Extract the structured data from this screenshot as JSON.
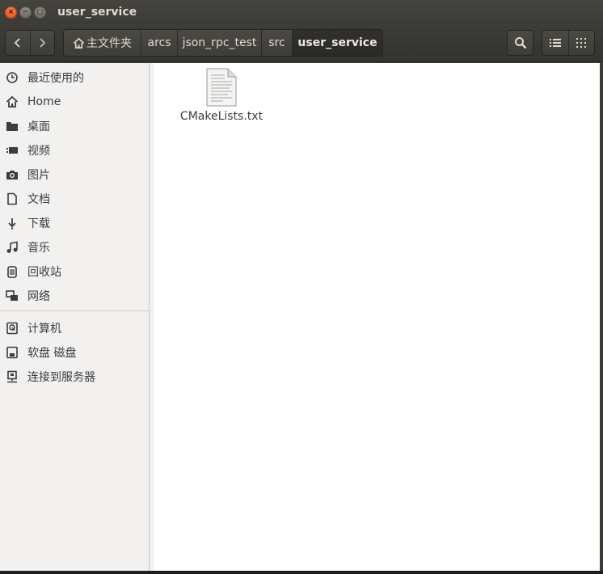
{
  "window": {
    "title": "user_service",
    "close_glyph": "×",
    "minimize_glyph": "−",
    "maximize_glyph": "□"
  },
  "toolbar": {
    "back_icon": "chevron-left-icon",
    "forward_icon": "chevron-right-icon",
    "search_icon": "search-icon",
    "list_view_icon": "list-view-icon",
    "grid_view_icon": "grid-view-icon"
  },
  "breadcrumb": {
    "home_label": "主文件夹",
    "items": [
      "arcs",
      "json_rpc_test",
      "src",
      "user_service"
    ]
  },
  "sidebar": {
    "places": [
      {
        "label": "最近使用的",
        "icon": "clock-icon"
      },
      {
        "label": "Home",
        "icon": "home-icon"
      },
      {
        "label": "桌面",
        "icon": "folder-icon"
      },
      {
        "label": "视频",
        "icon": "video-icon"
      },
      {
        "label": "图片",
        "icon": "camera-icon"
      },
      {
        "label": "文档",
        "icon": "document-icon"
      },
      {
        "label": "下载",
        "icon": "download-icon"
      },
      {
        "label": "音乐",
        "icon": "music-icon"
      },
      {
        "label": "回收站",
        "icon": "trash-icon"
      },
      {
        "label": "网络",
        "icon": "network-icon"
      }
    ],
    "devices": [
      {
        "label": "计算机",
        "icon": "computer-icon"
      },
      {
        "label": "软盘 磁盘",
        "icon": "floppy-icon"
      },
      {
        "label": "连接到服务器",
        "icon": "server-icon"
      }
    ]
  },
  "files": [
    {
      "name": "CMakeLists.txt",
      "icon": "text-file-icon"
    }
  ]
}
